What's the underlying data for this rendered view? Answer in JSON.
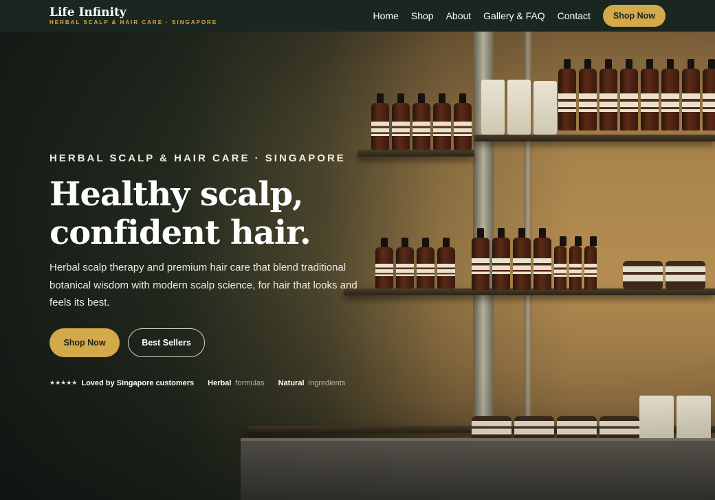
{
  "brand": {
    "name": "Life Infinity",
    "tagline": "HERBAL SCALP & HAIR CARE · SINGAPORE"
  },
  "nav": {
    "items": [
      {
        "label": "Home"
      },
      {
        "label": "Shop"
      },
      {
        "label": "About"
      },
      {
        "label": "Gallery & FAQ"
      },
      {
        "label": "Contact"
      }
    ],
    "cta_label": "Shop Now"
  },
  "hero": {
    "eyebrow": "HERBAL SCALP & HAIR CARE · SINGAPORE",
    "headline": "Healthy scalp, confident hair.",
    "subtext": "Herbal scalp therapy and premium hair care that blend traditional botanical wisdom with modern scalp science, for hair that looks and feels its best.",
    "primary_cta": "Shop Now",
    "secondary_cta": "Best Sellers"
  },
  "trust": {
    "stars": "★★★★★",
    "rating_label": "Loved by Singapore customers",
    "item2_bold": "Herbal",
    "item2_light": "formulas",
    "item3_bold": "Natural",
    "item3_light": "ingredients"
  },
  "colors": {
    "header_bg": "#1b2620",
    "accent": "#d4a94a",
    "text": "#ffffff"
  }
}
